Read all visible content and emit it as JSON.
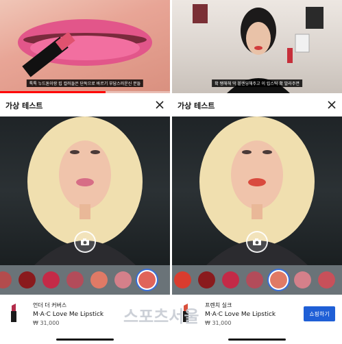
{
  "left": {
    "video": {
      "caption": "톡톡 누드톤이랑 립 컬러들은 단독으로 바르기 부담스러운신 분들",
      "progress": 0.62
    },
    "header": {
      "title": "가상 테스트"
    },
    "swatch_colors": [
      "#b34c4d",
      "#8a1a1d",
      "#c42a47",
      "#b34c5a",
      "#e07a66",
      "#d4808a",
      "#e0645a"
    ],
    "selected_swatch_index": 6,
    "product": {
      "name": "언더 더 커버스",
      "brand": "M·A·C Love Me Lipstick",
      "price": "₩ 31,000"
    }
  },
  "right": {
    "video": {
      "caption": "확 쨍해해 딱 블렌딩해주고 이 립스틱 확 발라주면",
      "progress": 0.0
    },
    "header": {
      "title": "가상 테스트"
    },
    "swatch_colors": [
      "#d93c2e",
      "#8a1a1d",
      "#c42a47",
      "#b34c5a",
      "#e07a66",
      "#d4808a",
      "#c8505a"
    ],
    "selected_swatch_index": 4,
    "product": {
      "name": "프렌치 실크",
      "brand": "M·A·C Love Me Lipstick",
      "price": "₩ 31,000",
      "shop_label": "쇼핑하기"
    }
  },
  "watermark": {
    "text": "스포츠서울"
  },
  "icons": {
    "close": "close-icon",
    "camera": "camera-icon",
    "lipstick": "lipstick-icon"
  },
  "colors": {
    "accent": "#1f5fd6",
    "progress": "#ff0000",
    "selected_ring": "#3a6fd8"
  }
}
